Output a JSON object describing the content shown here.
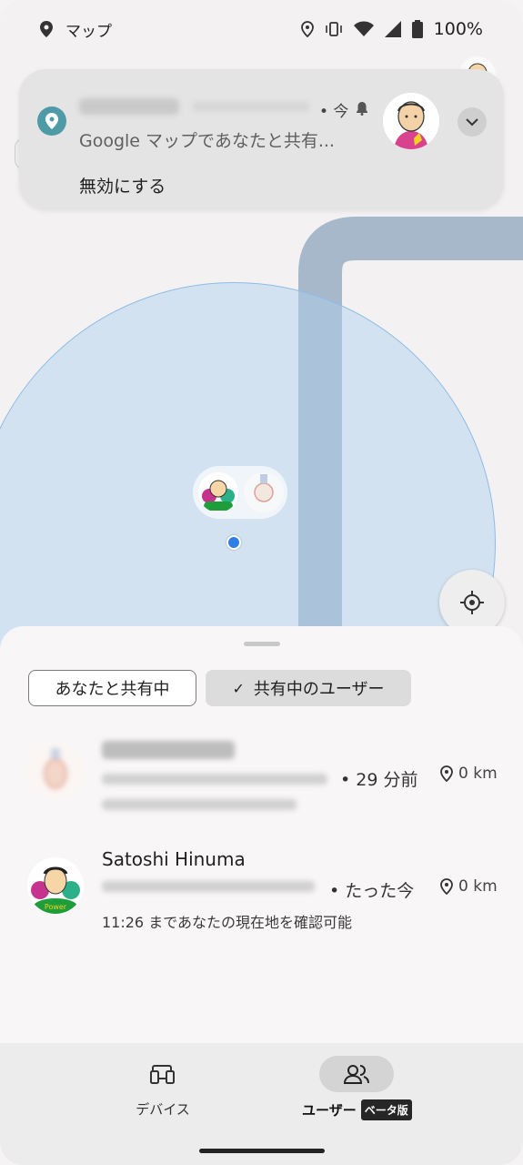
{
  "status_bar": {
    "app_name": "マップ",
    "battery": "100%"
  },
  "notification": {
    "time": "• 今",
    "message": "Google マップであなたと共有...",
    "action": "無効にする"
  },
  "chips": {
    "shared_with_you": "あなたと共有中",
    "sharing_users": "共有中のユーザー",
    "check": "✓"
  },
  "people": [
    {
      "name": "",
      "ago": "• 29 分前",
      "distance": "0 km",
      "until": ""
    },
    {
      "name": "Satoshi Hinuma",
      "ago": "• たった今",
      "distance": "0 km",
      "until": "11:26 まであなたの現在地を確認可能"
    }
  ],
  "nav": {
    "devices": "デバイス",
    "users": "ユーザー",
    "beta": "ベータ版"
  },
  "colors": {
    "accuracy_fill": "#add0f0",
    "blue_dot": "#2f7de6",
    "road": "#9aaec4",
    "notif_bg": "#e4e4e4",
    "app_icon": "#4e9aa6"
  }
}
